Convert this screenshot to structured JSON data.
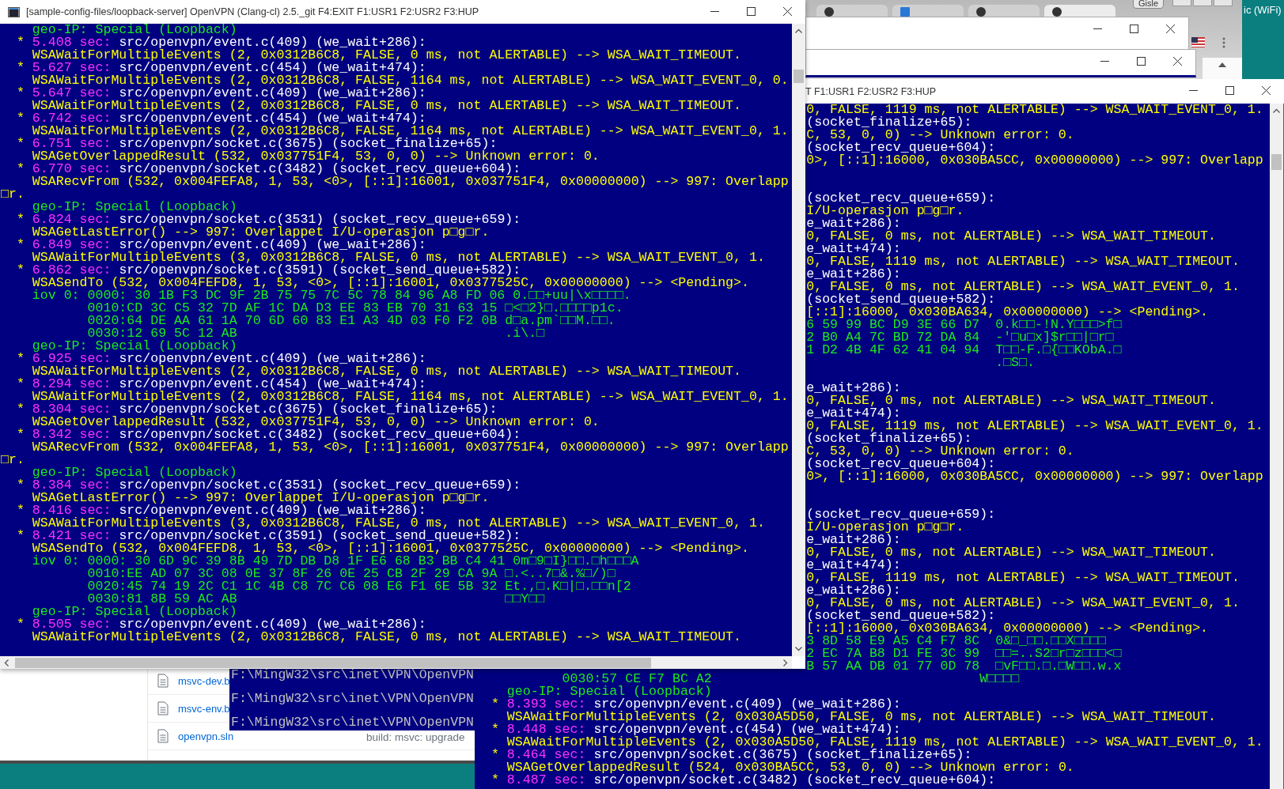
{
  "main_console": {
    "title": "[sample-config-files/loopback-server] OpenVPN (Clang-cl) 2.5._git F4:EXIT F1:USR1 F2:USR2 F3:HUP",
    "lines": [
      {
        "kind": "geo",
        "text": "geo-IP: Special (Loopback)"
      },
      {
        "kind": "trace",
        "bullet": "*",
        "time": "5.408 sec:",
        "source": "src/openvpn/event.c(409) (we_wait+286):"
      },
      {
        "kind": "call",
        "text": "WSAWaitForMultipleEvents (2, 0x0312B6C8, FALSE, 0 ms, not ALERTABLE) --> WSA_WAIT_TIMEOUT."
      },
      {
        "kind": "trace",
        "bullet": "*",
        "time": "5.627 sec:",
        "source": "src/openvpn/event.c(454) (we_wait+474):"
      },
      {
        "kind": "call",
        "text": "WSAWaitForMultipleEvents (2, 0x0312B6C8, FALSE, 1164 ms, not ALERTABLE) --> WSA_WAIT_EVENT_0, 0."
      },
      {
        "kind": "trace",
        "bullet": "*",
        "time": "5.647 sec:",
        "source": "src/openvpn/event.c(409) (we_wait+286):"
      },
      {
        "kind": "call",
        "text": "WSAWaitForMultipleEvents (2, 0x0312B6C8, FALSE, 0 ms, not ALERTABLE) --> WSA_WAIT_TIMEOUT."
      },
      {
        "kind": "trace",
        "bullet": "*",
        "time": "6.742 sec:",
        "source": "src/openvpn/event.c(454) (we_wait+474):"
      },
      {
        "kind": "call",
        "text": "WSAWaitForMultipleEvents (2, 0x0312B6C8, FALSE, 1164 ms, not ALERTABLE) --> WSA_WAIT_EVENT_0, 1."
      },
      {
        "kind": "trace",
        "bullet": "*",
        "time": "6.751 sec:",
        "source": "src/openvpn/socket.c(3675) (socket_finalize+65):"
      },
      {
        "kind": "call",
        "text": "WSAGetOverlappedResult (532, 0x037751F4, 53, 0, 0) --> Unknown error: 0."
      },
      {
        "kind": "trace",
        "bullet": "*",
        "time": "6.770 sec:",
        "source": "src/openvpn/socket.c(3482) (socket_recv_queue+604):"
      },
      {
        "kind": "call",
        "text": "WSARecvFrom (532, 0x004FEFA8, 1, 53, <0>, [::1]:16001, 0x037751F4, 0x00000000) --> 997: Overlapp"
      },
      {
        "kind": "wrap",
        "text": "□r."
      },
      {
        "kind": "geo",
        "text": "geo-IP: Special (Loopback)"
      },
      {
        "kind": "trace",
        "bullet": "*",
        "time": "6.824 sec:",
        "source": "src/openvpn/socket.c(3531) (socket_recv_queue+659):"
      },
      {
        "kind": "call",
        "text": "WSAGetLastError() --> 997: Overlappet I/U-operasjon p□g□r."
      },
      {
        "kind": "trace",
        "bullet": "*",
        "time": "6.849 sec:",
        "source": "src/openvpn/event.c(409) (we_wait+286):"
      },
      {
        "kind": "call",
        "text": "WSAWaitForMultipleEvents (3, 0x0312B6C8, FALSE, 0 ms, not ALERTABLE) --> WSA_WAIT_EVENT_0, 1."
      },
      {
        "kind": "trace",
        "bullet": "*",
        "time": "6.862 sec:",
        "source": "src/openvpn/socket.c(3591) (socket_send_queue+582):"
      },
      {
        "kind": "call",
        "text": "WSASendTo (532, 0x004FEFD8, 1, 53, <0>, [::1]:16001, 0x0377525C, 0x00000000) --> <Pending>."
      },
      {
        "kind": "hex",
        "label": "iov 0:",
        "offset": "0000:",
        "bytes": "30 1B F3 DC 9F 2B 75 75 7C 5C 78 84 96 A8 FD 06",
        "ascii": "0.□□+uu|\\x□□□□."
      },
      {
        "kind": "dump",
        "offset": "0010:",
        "bytes": "CD 3C C5 32 7D AF 1C DA D3 EE 83 EB 70 31 63 15",
        "ascii": "□<□2}□.□□□□p1c."
      },
      {
        "kind": "dump",
        "offset": "0020:",
        "bytes": "64 DE AA 61 1A 70 6D 60 83 E1 A3 4D 03 F0 F2 0B",
        "ascii": "d□a.pm`□□M.□□."
      },
      {
        "kind": "dump",
        "offset": "0030:",
        "bytes": "12 69 5C 12 AB",
        "ascii": ".i\\.□"
      },
      {
        "kind": "geo",
        "text": "geo-IP: Special (Loopback)"
      },
      {
        "kind": "trace",
        "bullet": "*",
        "time": "6.925 sec:",
        "source": "src/openvpn/event.c(409) (we_wait+286):"
      },
      {
        "kind": "call",
        "text": "WSAWaitForMultipleEvents (2, 0x0312B6C8, FALSE, 0 ms, not ALERTABLE) --> WSA_WAIT_TIMEOUT."
      },
      {
        "kind": "trace",
        "bullet": "*",
        "time": "8.294 sec:",
        "source": "src/openvpn/event.c(454) (we_wait+474):"
      },
      {
        "kind": "call",
        "text": "WSAWaitForMultipleEvents (2, 0x0312B6C8, FALSE, 1164 ms, not ALERTABLE) --> WSA_WAIT_EVENT_0, 1."
      },
      {
        "kind": "trace",
        "bullet": "*",
        "time": "8.304 sec:",
        "source": "src/openvpn/socket.c(3675) (socket_finalize+65):"
      },
      {
        "kind": "call",
        "text": "WSAGetOverlappedResult (532, 0x037751F4, 53, 0, 0) --> Unknown error: 0."
      },
      {
        "kind": "trace",
        "bullet": "*",
        "time": "8.342 sec:",
        "source": "src/openvpn/socket.c(3482) (socket_recv_queue+604):"
      },
      {
        "kind": "call",
        "text": "WSARecvFrom (532, 0x004FEFA8, 1, 53, <0>, [::1]:16001, 0x037751F4, 0x00000000) --> 997: Overlapp"
      },
      {
        "kind": "wrap",
        "text": "□r."
      },
      {
        "kind": "geo",
        "text": "geo-IP: Special (Loopback)"
      },
      {
        "kind": "trace",
        "bullet": "*",
        "time": "8.384 sec:",
        "source": "src/openvpn/socket.c(3531) (socket_recv_queue+659):"
      },
      {
        "kind": "call",
        "text": "WSAGetLastError() --> 997: Overlappet I/U-operasjon p□g□r."
      },
      {
        "kind": "trace",
        "bullet": "*",
        "time": "8.416 sec:",
        "source": "src/openvpn/event.c(409) (we_wait+286):"
      },
      {
        "kind": "call",
        "text": "WSAWaitForMultipleEvents (3, 0x0312B6C8, FALSE, 0 ms, not ALERTABLE) --> WSA_WAIT_EVENT_0, 1."
      },
      {
        "kind": "trace",
        "bullet": "*",
        "time": "8.421 sec:",
        "source": "src/openvpn/socket.c(3591) (socket_send_queue+582):"
      },
      {
        "kind": "call",
        "text": "WSASendTo (532, 0x004FEFD8, 1, 53, <0>, [::1]:16001, 0x0377525C, 0x00000000) --> <Pending>."
      },
      {
        "kind": "hex",
        "label": "iov 0:",
        "offset": "0000:",
        "bytes": "30 6D 9C 39 8B 49 7D DB D8 1F E6 68 B3 BB C4 41",
        "ascii": "0m□9□I}□□.□h□□□A"
      },
      {
        "kind": "dump",
        "offset": "0010:",
        "bytes": "EE AD 07 3C 08 0E 37 8F 26 0E 25 CB 2F 29 CA 9A",
        "ascii": "□.<..7□&.%□/)□"
      },
      {
        "kind": "dump",
        "offset": "0020:",
        "bytes": "45 74 19 2C C1 1C 4B C8 7C C6 08 E6 F1 6E 5B 32",
        "ascii": "Et.,□.K□|□.□□n[2"
      },
      {
        "kind": "dump",
        "offset": "0030:",
        "bytes": "81 8B 59 AC AB",
        "ascii": "□□Y□□"
      },
      {
        "kind": "geo",
        "text": "geo-IP: Special (Loopback)"
      },
      {
        "kind": "trace",
        "bullet": "*",
        "time": "8.505 sec:",
        "source": "src/openvpn/event.c(409) (we_wait+286):"
      },
      {
        "kind": "call",
        "text": "WSAWaitForMultipleEvents (2, 0x0312B6C8, FALSE, 0 ms, not ALERTABLE) --> WSA_WAIT_TIMEOUT."
      }
    ]
  },
  "right_console": {
    "title": "T F1:USR1 F2:USR2 F3:HUP",
    "covered_lines": [
      {
        "kind": "call",
        "text": "0, FALSE, 1119 ms, not ALERTABLE) --> WSA_WAIT_EVENT_0, 1."
      },
      {
        "kind": "source",
        "text": "(socket_finalize+65):"
      },
      {
        "kind": "call",
        "text": "C, 53, 0, 0) --> Unknown error: 0."
      },
      {
        "kind": "source",
        "text": "(socket_recv_queue+604):"
      },
      {
        "kind": "call",
        "text": "0>, [::1]:16000, 0x030BA5CC, 0x00000000) --> 997: Overlapp"
      },
      {
        "kind": "blank"
      },
      {
        "kind": "blank"
      },
      {
        "kind": "source",
        "text": "(socket_recv_queue+659):"
      },
      {
        "kind": "call",
        "text": "I/U-operasjon p□g□r."
      },
      {
        "kind": "source",
        "text": "e_wait+286):"
      },
      {
        "kind": "call",
        "text": "0, FALSE, 0 ms, not ALERTABLE) --> WSA_WAIT_TIMEOUT."
      },
      {
        "kind": "source",
        "text": "e_wait+474):"
      },
      {
        "kind": "call",
        "text": "0, FALSE, 1119 ms, not ALERTABLE) --> WSA_WAIT_TIMEOUT."
      },
      {
        "kind": "source",
        "text": "e_wait+286):"
      },
      {
        "kind": "call",
        "text": "0, FALSE, 0 ms, not ALERTABLE) --> WSA_WAIT_EVENT_0, 1."
      },
      {
        "kind": "source",
        "text": "(socket_send_queue+582):"
      },
      {
        "kind": "call",
        "text": "[::1]:16000, 0x030BA634, 0x00000000) --> <Pending>."
      },
      {
        "kind": "dump",
        "bytes": "6 59 99 BC D9 3E 66 D7",
        "ascii": "0.k□□-!N.Y□□□>f□"
      },
      {
        "kind": "dump",
        "bytes": "2 B0 A4 7C BD 72 DA 84",
        "ascii": "-'□u□x]$r□□|□r□"
      },
      {
        "kind": "dump",
        "bytes": "1 D2 4B 4F 62 41 04 94",
        "ascii": "T□□-F.□{□□KObA.□"
      },
      {
        "kind": "dump",
        "ascii": ".□S□."
      },
      {
        "kind": "blank"
      },
      {
        "kind": "source",
        "text": "e_wait+286):"
      },
      {
        "kind": "call",
        "text": "0, FALSE, 0 ms, not ALERTABLE) --> WSA_WAIT_TIMEOUT."
      },
      {
        "kind": "source",
        "text": "e_wait+474):"
      },
      {
        "kind": "call",
        "text": "0, FALSE, 1119 ms, not ALERTABLE) --> WSA_WAIT_EVENT_0, 1."
      },
      {
        "kind": "source",
        "text": "(socket_finalize+65):"
      },
      {
        "kind": "call",
        "text": "C, 53, 0, 0) --> Unknown error: 0."
      },
      {
        "kind": "source",
        "text": "(socket_recv_queue+604):"
      },
      {
        "kind": "call",
        "text": "0>, [::1]:16000, 0x030BA5CC, 0x00000000) --> 997: Overlapp"
      },
      {
        "kind": "blank"
      },
      {
        "kind": "blank"
      },
      {
        "kind": "source",
        "text": "(socket_recv_queue+659):"
      },
      {
        "kind": "call",
        "text": "I/U-operasjon p□g□r."
      },
      {
        "kind": "source",
        "text": "e_wait+286):"
      },
      {
        "kind": "call",
        "text": "0, FALSE, 0 ms, not ALERTABLE) --> WSA_WAIT_TIMEOUT."
      },
      {
        "kind": "source",
        "text": "e_wait+474):"
      },
      {
        "kind": "call",
        "text": "0, FALSE, 1119 ms, not ALERTABLE) --> WSA_WAIT_TIMEOUT."
      },
      {
        "kind": "source",
        "text": "e_wait+286):"
      },
      {
        "kind": "call",
        "text": "0, FALSE, 0 ms, not ALERTABLE) --> WSA_WAIT_EVENT_0, 1."
      },
      {
        "kind": "source",
        "text": "(socket_send_queue+582):"
      },
      {
        "kind": "call",
        "text": "[::1]:16000, 0x030BA634, 0x00000000) --> <Pending>."
      },
      {
        "kind": "dump",
        "bytes": "3 8D 58 E9 A5 C4 F7 8C",
        "ascii": "0&□_□□.□□X□□□□"
      },
      {
        "kind": "dump",
        "bytes": "2 EC 7A B8 D1 FE 3C 99",
        "ascii": "□□=..S2□r□z□□□<□"
      },
      {
        "kind": "dump",
        "bytes": "B 57 AA DB 01 77 0D 78",
        "ascii": "□vF□□.□.□W□□.w.x"
      }
    ],
    "lines": [
      {
        "kind": "dump",
        "offset": "0030:",
        "bytes": "57 CE F7 BC A2",
        "ascii": "W□□□□"
      },
      {
        "kind": "geo",
        "text": "geo-IP: Special (Loopback)"
      },
      {
        "kind": "trace",
        "bullet": "*",
        "time": "8.393 sec:",
        "source": "src/openvpn/event.c(409) (we_wait+286):"
      },
      {
        "kind": "call",
        "text": "WSAWaitForMultipleEvents (2, 0x030A5D50, FALSE, 0 ms, not ALERTABLE) --> WSA_WAIT_TIMEOUT."
      },
      {
        "kind": "trace",
        "bullet": "*",
        "time": "8.448 sec:",
        "source": "src/openvpn/event.c(454) (we_wait+474):"
      },
      {
        "kind": "call",
        "text": "WSAWaitForMultipleEvents (2, 0x030A5D50, FALSE, 1119 ms, not ALERTABLE) --> WSA_WAIT_EVENT_0, 1."
      },
      {
        "kind": "trace",
        "bullet": "*",
        "time": "8.464 sec:",
        "source": "src/openvpn/socket.c(3675) (socket_finalize+65):"
      },
      {
        "kind": "call",
        "text": "WSAGetOverlappedResult (524, 0x030BA5CC, 53, 0, 0) --> Unknown error: 0."
      },
      {
        "kind": "trace",
        "bullet": "*",
        "time": "8.487 sec:",
        "source": "src/openvpn/socket.c(3482) (socket_recv_queue+604):"
      }
    ]
  },
  "small_console": {
    "lines": [
      "F:\\MingW32\\src\\inet\\VPN\\OpenVPN",
      "F:\\MingW32\\src\\inet\\VPN\\OpenVPN",
      "F:\\MingW32\\src\\inet\\VPN\\OpenVPN"
    ]
  },
  "file_list": {
    "items": [
      {
        "name": "msvc-dev.b"
      },
      {
        "name": "msvc-env.b"
      },
      {
        "name": "openvpn.sln",
        "commit": "build: msvc: upgrade"
      }
    ]
  },
  "browser": {
    "tabs": [
      {
        "selected": false
      },
      {
        "selected": false
      },
      {
        "selected": false
      },
      {
        "selected": true
      }
    ],
    "profile": "Gisle"
  },
  "tray": {
    "network": "ic (WiFi)"
  }
}
